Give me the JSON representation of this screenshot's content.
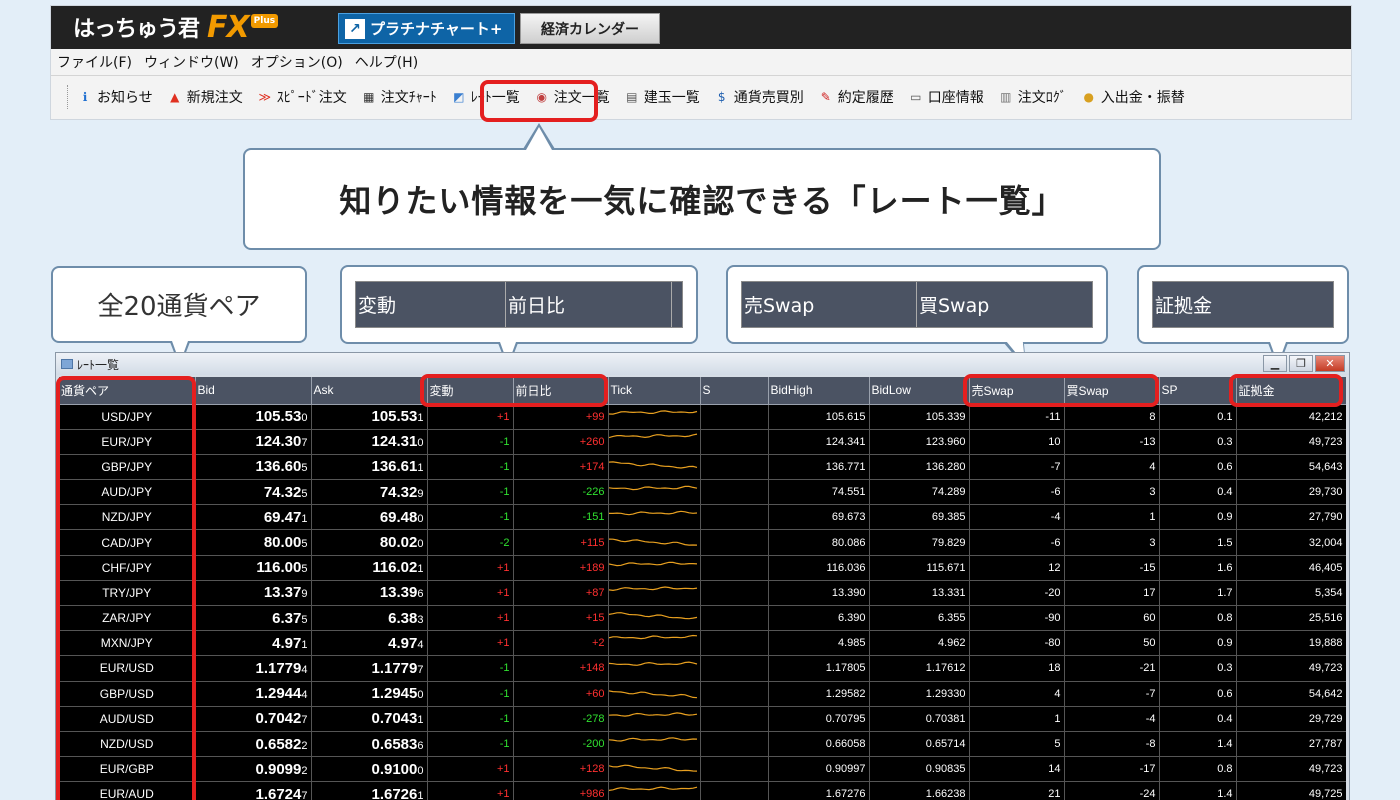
{
  "app": {
    "logo_text": "はっちゅう君",
    "logo_fx": "FX",
    "logo_plus": "Plus",
    "tab_platinum": "プラチナチャート+",
    "tab_calendar": "経済カレンダー"
  },
  "menu": [
    "ファイル(F)",
    "ウィンドウ(W)",
    "オプション(O)",
    "ヘルプ(H)"
  ],
  "toolbar": [
    {
      "label": "お知らせ",
      "icon": "info-icon",
      "glyph": "ℹ",
      "color": "#1f6fd0"
    },
    {
      "label": "新規注文",
      "icon": "new-order-icon",
      "glyph": "▲",
      "color": "#e03020"
    },
    {
      "label": "ｽﾋﾟｰﾄﾞ注文",
      "icon": "speed-order-icon",
      "glyph": "≫",
      "color": "#e03020"
    },
    {
      "label": "注文ﾁｬｰﾄ",
      "icon": "order-chart-icon",
      "glyph": "▦",
      "color": "#333"
    },
    {
      "label": "ﾚｰﾄ一覧",
      "icon": "rate-list-icon",
      "glyph": "◩",
      "color": "#3a7fd0"
    },
    {
      "label": "注文一覧",
      "icon": "order-list-icon",
      "glyph": "◉",
      "color": "#c04040"
    },
    {
      "label": "建玉一覧",
      "icon": "position-list-icon",
      "glyph": "▤",
      "color": "#555"
    },
    {
      "label": "通貨売買別",
      "icon": "currency-icon",
      "glyph": "$",
      "color": "#2060b0"
    },
    {
      "label": "約定履歴",
      "icon": "history-icon",
      "glyph": "✎",
      "color": "#d02020"
    },
    {
      "label": "口座情報",
      "icon": "account-icon",
      "glyph": "▭",
      "color": "#555"
    },
    {
      "label": "注文ﾛｸﾞ",
      "icon": "order-log-icon",
      "glyph": "▥",
      "color": "#777"
    },
    {
      "label": "入出金・振替",
      "icon": "deposit-icon",
      "glyph": "●",
      "color": "#d8a020"
    }
  ],
  "callouts": {
    "main": "知りたい情報を一気に確認できる「レート一覧」",
    "pairs": "全20通貨ペア",
    "change": [
      "変動",
      "前日比"
    ],
    "swap": [
      "売Swap",
      "買Swap"
    ],
    "margin": "証拠金"
  },
  "rate_window": {
    "title": "ﾚｰﾄ一覧",
    "columns": [
      "通貨ペア",
      "Bid",
      "Ask",
      "変動",
      "前日比",
      "Tick",
      "S",
      "BidHigh",
      "BidLow",
      "売Swap",
      "買Swap",
      "SP",
      "証拠金"
    ],
    "rows": [
      {
        "pair": "USD/JPY",
        "bid": "105.53",
        "bid_s": "0",
        "ask": "105.53",
        "ask_s": "1",
        "chg": "+1",
        "prev": "+99",
        "high": "105.615",
        "low": "105.339",
        "sswap": "-11",
        "bswap": "8",
        "sp": "0.1",
        "margin": "42,212"
      },
      {
        "pair": "EUR/JPY",
        "bid": "124.30",
        "bid_s": "7",
        "ask": "124.31",
        "ask_s": "0",
        "chg": "-1",
        "prev": "+260",
        "high": "124.341",
        "low": "123.960",
        "sswap": "10",
        "bswap": "-13",
        "sp": "0.3",
        "margin": "49,723"
      },
      {
        "pair": "GBP/JPY",
        "bid": "136.60",
        "bid_s": "5",
        "ask": "136.61",
        "ask_s": "1",
        "chg": "-1",
        "prev": "+174",
        "high": "136.771",
        "low": "136.280",
        "sswap": "-7",
        "bswap": "4",
        "sp": "0.6",
        "margin": "54,643"
      },
      {
        "pair": "AUD/JPY",
        "bid": "74.32",
        "bid_s": "5",
        "ask": "74.32",
        "ask_s": "9",
        "chg": "-1",
        "prev": "-226",
        "high": "74.551",
        "low": "74.289",
        "sswap": "-6",
        "bswap": "3",
        "sp": "0.4",
        "margin": "29,730"
      },
      {
        "pair": "NZD/JPY",
        "bid": "69.47",
        "bid_s": "1",
        "ask": "69.48",
        "ask_s": "0",
        "chg": "-1",
        "prev": "-151",
        "high": "69.673",
        "low": "69.385",
        "sswap": "-4",
        "bswap": "1",
        "sp": "0.9",
        "margin": "27,790"
      },
      {
        "pair": "CAD/JPY",
        "bid": "80.00",
        "bid_s": "5",
        "ask": "80.02",
        "ask_s": "0",
        "chg": "-2",
        "prev": "+115",
        "high": "80.086",
        "low": "79.829",
        "sswap": "-6",
        "bswap": "3",
        "sp": "1.5",
        "margin": "32,004"
      },
      {
        "pair": "CHF/JPY",
        "bid": "116.00",
        "bid_s": "5",
        "ask": "116.02",
        "ask_s": "1",
        "chg": "+1",
        "prev": "+189",
        "high": "116.036",
        "low": "115.671",
        "sswap": "12",
        "bswap": "-15",
        "sp": "1.6",
        "margin": "46,405"
      },
      {
        "pair": "TRY/JPY",
        "bid": "13.37",
        "bid_s": "9",
        "ask": "13.39",
        "ask_s": "6",
        "chg": "+1",
        "prev": "+87",
        "high": "13.390",
        "low": "13.331",
        "sswap": "-20",
        "bswap": "17",
        "sp": "1.7",
        "margin": "5,354"
      },
      {
        "pair": "ZAR/JPY",
        "bid": "6.37",
        "bid_s": "5",
        "ask": "6.38",
        "ask_s": "3",
        "chg": "+1",
        "prev": "+15",
        "high": "6.390",
        "low": "6.355",
        "sswap": "-90",
        "bswap": "60",
        "sp": "0.8",
        "margin": "25,516"
      },
      {
        "pair": "MXN/JPY",
        "bid": "4.97",
        "bid_s": "1",
        "ask": "4.97",
        "ask_s": "4",
        "chg": "+1",
        "prev": "+2",
        "high": "4.985",
        "low": "4.962",
        "sswap": "-80",
        "bswap": "50",
        "sp": "0.9",
        "margin": "19,888"
      },
      {
        "pair": "EUR/USD",
        "bid": "1.1779",
        "bid_s": "4",
        "ask": "1.1779",
        "ask_s": "7",
        "chg": "-1",
        "prev": "+148",
        "high": "1.17805",
        "low": "1.17612",
        "sswap": "18",
        "bswap": "-21",
        "sp": "0.3",
        "margin": "49,723"
      },
      {
        "pair": "GBP/USD",
        "bid": "1.2944",
        "bid_s": "4",
        "ask": "1.2945",
        "ask_s": "0",
        "chg": "-1",
        "prev": "+60",
        "high": "1.29582",
        "low": "1.29330",
        "sswap": "4",
        "bswap": "-7",
        "sp": "0.6",
        "margin": "54,642"
      },
      {
        "pair": "AUD/USD",
        "bid": "0.7042",
        "bid_s": "7",
        "ask": "0.7043",
        "ask_s": "1",
        "chg": "-1",
        "prev": "-278",
        "high": "0.70795",
        "low": "0.70381",
        "sswap": "1",
        "bswap": "-4",
        "sp": "0.4",
        "margin": "29,729"
      },
      {
        "pair": "NZD/USD",
        "bid": "0.6582",
        "bid_s": "2",
        "ask": "0.6583",
        "ask_s": "6",
        "chg": "-1",
        "prev": "-200",
        "high": "0.66058",
        "low": "0.65714",
        "sswap": "5",
        "bswap": "-8",
        "sp": "1.4",
        "margin": "27,787"
      },
      {
        "pair": "EUR/GBP",
        "bid": "0.9099",
        "bid_s": "2",
        "ask": "0.9100",
        "ask_s": "0",
        "chg": "+1",
        "prev": "+128",
        "high": "0.90997",
        "low": "0.90835",
        "sswap": "14",
        "bswap": "-17",
        "sp": "0.8",
        "margin": "49,723"
      },
      {
        "pair": "EUR/AUD",
        "bid": "1.6724",
        "bid_s": "7",
        "ask": "1.6726",
        "ask_s": "1",
        "chg": "+1",
        "prev": "+986",
        "high": "1.67276",
        "low": "1.66238",
        "sswap": "21",
        "bswap": "-24",
        "sp": "1.4",
        "margin": "49,725"
      }
    ]
  }
}
